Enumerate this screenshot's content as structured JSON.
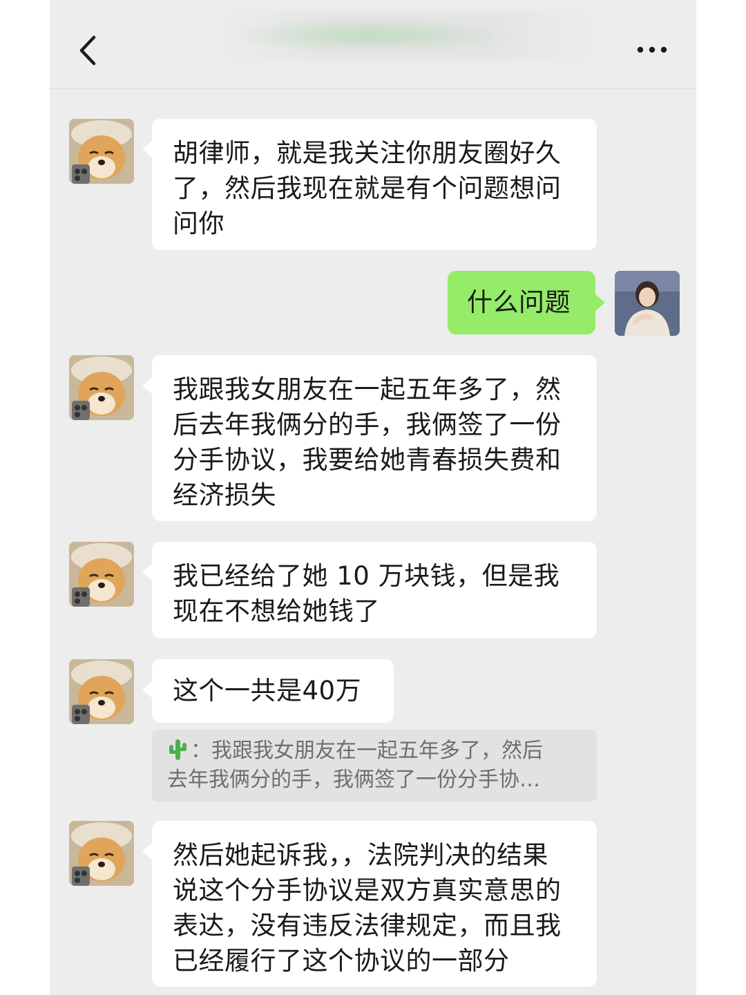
{
  "header": {
    "back_label": "<",
    "title": "",
    "more_label": "···"
  },
  "messages": [
    {
      "id": "m1",
      "side": "left",
      "text": "胡律师，就是我关注你朋友圈好久了，然后我现在就是有个问题想问问你",
      "lines": [
        "胡律师，就是我关注你朋友圈好久",
        "了，然后我现在就是有个问题想问",
        "问你"
      ]
    },
    {
      "id": "m2",
      "side": "right",
      "text": "什么问题"
    },
    {
      "id": "m3",
      "side": "left",
      "lines": [
        "我跟我女朋友在一起五年多了，然",
        "后去年我俩分的手，我俩签了一份",
        "分手协议，我要给她青春损失费和",
        "经济损失"
      ]
    },
    {
      "id": "m4",
      "side": "left",
      "lines": [
        "我已经给了她 10 万块钱，但是我",
        "现在不想给她钱了"
      ]
    },
    {
      "id": "m5",
      "side": "left",
      "lines": [
        "这个一共是40万"
      ]
    },
    {
      "id": "m6",
      "side": "left",
      "lines": [
        "然后她起诉我，，法院判决的结果",
        "说这个分手协议是双方真实意思的",
        "表达，没有违反法律规定，而且我",
        "已经履行了这个协议的一部分"
      ]
    }
  ],
  "quote": {
    "icon": "cactus-icon",
    "sender_sep": "：",
    "lines": [
      "我跟我女朋友在一起五年多了，然后",
      "去年我俩分的手，我俩签了一份分手协…"
    ]
  },
  "colors": {
    "background": "#ededed",
    "bubble_left": "#ffffff",
    "bubble_right": "#95ec69",
    "quote_bg": "#e2e2e2"
  }
}
